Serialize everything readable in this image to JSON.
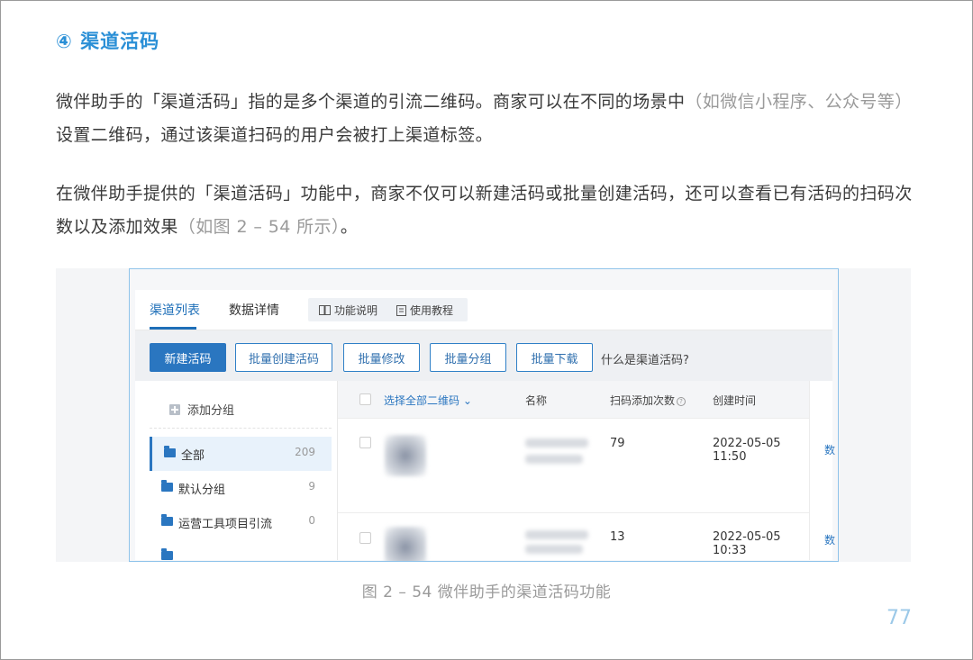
{
  "heading": "④ 渠道活码",
  "paragraph1": {
    "main": "微伴助手的「渠道活码」指的是多个渠道的引流二维码。商家可以在不同的场景中",
    "muted": "（如微信小程序、公众号等）",
    "tail": "设置二维码，通过该渠道扫码的用户会被打上渠道标签。"
  },
  "paragraph2": {
    "main": "在微伴助手提供的「渠道活码」功能中，商家不仅可以新建活码或批量创建活码，还可以查看已有活码的扫码次数以及添加效果",
    "muted": "（如图 2 – 54 所示）",
    "tail": "。"
  },
  "screenshot": {
    "tabs": [
      "渠道列表",
      "数据详情"
    ],
    "help_links": [
      "功能说明",
      "使用教程"
    ],
    "buttons": [
      "新建活码",
      "批量创建活码",
      "批量修改",
      "批量分组",
      "批量下载"
    ],
    "toolbar_link": "什么是渠道活码?",
    "add_group": "添加分组",
    "groups": [
      {
        "name": "全部",
        "count": "209"
      },
      {
        "name": "默认分组",
        "count": "9"
      },
      {
        "name": "运营工具项目引流",
        "count": "0"
      }
    ],
    "table_headers": {
      "select_all": "选择全部二维码",
      "name": "名称",
      "scan_count": "扫码添加次数",
      "created": "创建时间"
    },
    "rows": [
      {
        "scans": "79",
        "created": "2022-05-05 11:50",
        "action": "数"
      },
      {
        "scans": "13",
        "created": "2022-05-05 10:33",
        "action": "数"
      }
    ]
  },
  "caption": "图 2 – 54 微伴助手的渠道活码功能",
  "page_number": "77",
  "colors": {
    "accent": "#2a8fd6",
    "primary_button": "#2a76c0",
    "muted_text": "#9a9a9a"
  }
}
